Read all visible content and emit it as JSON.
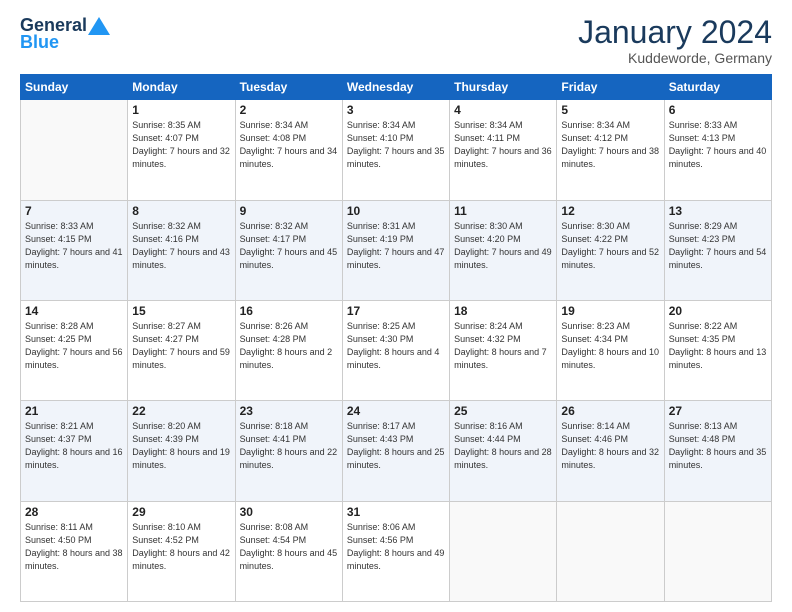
{
  "header": {
    "logo_general": "General",
    "logo_blue": "Blue",
    "month_title": "January 2024",
    "location": "Kuddeworde, Germany"
  },
  "weekdays": [
    "Sunday",
    "Monday",
    "Tuesday",
    "Wednesday",
    "Thursday",
    "Friday",
    "Saturday"
  ],
  "weeks": [
    [
      {
        "day": "",
        "sunrise": "",
        "sunset": "",
        "daylight": ""
      },
      {
        "day": "1",
        "sunrise": "Sunrise: 8:35 AM",
        "sunset": "Sunset: 4:07 PM",
        "daylight": "Daylight: 7 hours and 32 minutes."
      },
      {
        "day": "2",
        "sunrise": "Sunrise: 8:34 AM",
        "sunset": "Sunset: 4:08 PM",
        "daylight": "Daylight: 7 hours and 34 minutes."
      },
      {
        "day": "3",
        "sunrise": "Sunrise: 8:34 AM",
        "sunset": "Sunset: 4:10 PM",
        "daylight": "Daylight: 7 hours and 35 minutes."
      },
      {
        "day": "4",
        "sunrise": "Sunrise: 8:34 AM",
        "sunset": "Sunset: 4:11 PM",
        "daylight": "Daylight: 7 hours and 36 minutes."
      },
      {
        "day": "5",
        "sunrise": "Sunrise: 8:34 AM",
        "sunset": "Sunset: 4:12 PM",
        "daylight": "Daylight: 7 hours and 38 minutes."
      },
      {
        "day": "6",
        "sunrise": "Sunrise: 8:33 AM",
        "sunset": "Sunset: 4:13 PM",
        "daylight": "Daylight: 7 hours and 40 minutes."
      }
    ],
    [
      {
        "day": "7",
        "sunrise": "Sunrise: 8:33 AM",
        "sunset": "Sunset: 4:15 PM",
        "daylight": "Daylight: 7 hours and 41 minutes."
      },
      {
        "day": "8",
        "sunrise": "Sunrise: 8:32 AM",
        "sunset": "Sunset: 4:16 PM",
        "daylight": "Daylight: 7 hours and 43 minutes."
      },
      {
        "day": "9",
        "sunrise": "Sunrise: 8:32 AM",
        "sunset": "Sunset: 4:17 PM",
        "daylight": "Daylight: 7 hours and 45 minutes."
      },
      {
        "day": "10",
        "sunrise": "Sunrise: 8:31 AM",
        "sunset": "Sunset: 4:19 PM",
        "daylight": "Daylight: 7 hours and 47 minutes."
      },
      {
        "day": "11",
        "sunrise": "Sunrise: 8:30 AM",
        "sunset": "Sunset: 4:20 PM",
        "daylight": "Daylight: 7 hours and 49 minutes."
      },
      {
        "day": "12",
        "sunrise": "Sunrise: 8:30 AM",
        "sunset": "Sunset: 4:22 PM",
        "daylight": "Daylight: 7 hours and 52 minutes."
      },
      {
        "day": "13",
        "sunrise": "Sunrise: 8:29 AM",
        "sunset": "Sunset: 4:23 PM",
        "daylight": "Daylight: 7 hours and 54 minutes."
      }
    ],
    [
      {
        "day": "14",
        "sunrise": "Sunrise: 8:28 AM",
        "sunset": "Sunset: 4:25 PM",
        "daylight": "Daylight: 7 hours and 56 minutes."
      },
      {
        "day": "15",
        "sunrise": "Sunrise: 8:27 AM",
        "sunset": "Sunset: 4:27 PM",
        "daylight": "Daylight: 7 hours and 59 minutes."
      },
      {
        "day": "16",
        "sunrise": "Sunrise: 8:26 AM",
        "sunset": "Sunset: 4:28 PM",
        "daylight": "Daylight: 8 hours and 2 minutes."
      },
      {
        "day": "17",
        "sunrise": "Sunrise: 8:25 AM",
        "sunset": "Sunset: 4:30 PM",
        "daylight": "Daylight: 8 hours and 4 minutes."
      },
      {
        "day": "18",
        "sunrise": "Sunrise: 8:24 AM",
        "sunset": "Sunset: 4:32 PM",
        "daylight": "Daylight: 8 hours and 7 minutes."
      },
      {
        "day": "19",
        "sunrise": "Sunrise: 8:23 AM",
        "sunset": "Sunset: 4:34 PM",
        "daylight": "Daylight: 8 hours and 10 minutes."
      },
      {
        "day": "20",
        "sunrise": "Sunrise: 8:22 AM",
        "sunset": "Sunset: 4:35 PM",
        "daylight": "Daylight: 8 hours and 13 minutes."
      }
    ],
    [
      {
        "day": "21",
        "sunrise": "Sunrise: 8:21 AM",
        "sunset": "Sunset: 4:37 PM",
        "daylight": "Daylight: 8 hours and 16 minutes."
      },
      {
        "day": "22",
        "sunrise": "Sunrise: 8:20 AM",
        "sunset": "Sunset: 4:39 PM",
        "daylight": "Daylight: 8 hours and 19 minutes."
      },
      {
        "day": "23",
        "sunrise": "Sunrise: 8:18 AM",
        "sunset": "Sunset: 4:41 PM",
        "daylight": "Daylight: 8 hours and 22 minutes."
      },
      {
        "day": "24",
        "sunrise": "Sunrise: 8:17 AM",
        "sunset": "Sunset: 4:43 PM",
        "daylight": "Daylight: 8 hours and 25 minutes."
      },
      {
        "day": "25",
        "sunrise": "Sunrise: 8:16 AM",
        "sunset": "Sunset: 4:44 PM",
        "daylight": "Daylight: 8 hours and 28 minutes."
      },
      {
        "day": "26",
        "sunrise": "Sunrise: 8:14 AM",
        "sunset": "Sunset: 4:46 PM",
        "daylight": "Daylight: 8 hours and 32 minutes."
      },
      {
        "day": "27",
        "sunrise": "Sunrise: 8:13 AM",
        "sunset": "Sunset: 4:48 PM",
        "daylight": "Daylight: 8 hours and 35 minutes."
      }
    ],
    [
      {
        "day": "28",
        "sunrise": "Sunrise: 8:11 AM",
        "sunset": "Sunset: 4:50 PM",
        "daylight": "Daylight: 8 hours and 38 minutes."
      },
      {
        "day": "29",
        "sunrise": "Sunrise: 8:10 AM",
        "sunset": "Sunset: 4:52 PM",
        "daylight": "Daylight: 8 hours and 42 minutes."
      },
      {
        "day": "30",
        "sunrise": "Sunrise: 8:08 AM",
        "sunset": "Sunset: 4:54 PM",
        "daylight": "Daylight: 8 hours and 45 minutes."
      },
      {
        "day": "31",
        "sunrise": "Sunrise: 8:06 AM",
        "sunset": "Sunset: 4:56 PM",
        "daylight": "Daylight: 8 hours and 49 minutes."
      },
      {
        "day": "",
        "sunrise": "",
        "sunset": "",
        "daylight": ""
      },
      {
        "day": "",
        "sunrise": "",
        "sunset": "",
        "daylight": ""
      },
      {
        "day": "",
        "sunrise": "",
        "sunset": "",
        "daylight": ""
      }
    ]
  ]
}
